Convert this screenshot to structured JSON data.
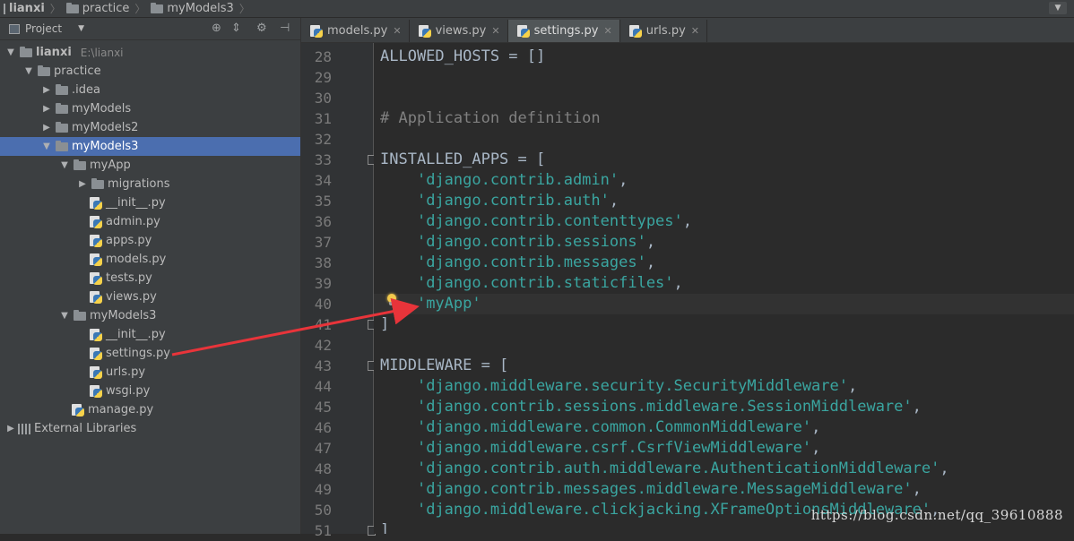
{
  "breadcrumb": [
    "lianxi",
    "practice",
    "myModels3"
  ],
  "project_panel": {
    "title": "Project",
    "root_name": "lianxi",
    "root_path": "E:\\lianxi",
    "tree": [
      {
        "label": "lianxi",
        "depth": 0,
        "type": "root",
        "expanded": true
      },
      {
        "label": "practice",
        "depth": 1,
        "type": "folder",
        "expanded": true
      },
      {
        "label": ".idea",
        "depth": 2,
        "type": "folder",
        "expanded": false
      },
      {
        "label": "myModels",
        "depth": 2,
        "type": "folder",
        "expanded": false
      },
      {
        "label": "myModels2",
        "depth": 2,
        "type": "folder",
        "expanded": false
      },
      {
        "label": "myModels3",
        "depth": 2,
        "type": "folder",
        "expanded": true,
        "selected": true
      },
      {
        "label": "myApp",
        "depth": 3,
        "type": "folder",
        "expanded": true
      },
      {
        "label": "migrations",
        "depth": 4,
        "type": "folder",
        "expanded": false
      },
      {
        "label": "__init__.py",
        "depth": 4,
        "type": "py"
      },
      {
        "label": "admin.py",
        "depth": 4,
        "type": "py"
      },
      {
        "label": "apps.py",
        "depth": 4,
        "type": "py"
      },
      {
        "label": "models.py",
        "depth": 4,
        "type": "py"
      },
      {
        "label": "tests.py",
        "depth": 4,
        "type": "py"
      },
      {
        "label": "views.py",
        "depth": 4,
        "type": "py"
      },
      {
        "label": "myModels3",
        "depth": 3,
        "type": "folder",
        "expanded": true
      },
      {
        "label": "__init__.py",
        "depth": 4,
        "type": "py"
      },
      {
        "label": "settings.py",
        "depth": 4,
        "type": "py"
      },
      {
        "label": "urls.py",
        "depth": 4,
        "type": "py"
      },
      {
        "label": "wsgi.py",
        "depth": 4,
        "type": "py"
      },
      {
        "label": "manage.py",
        "depth": 3,
        "type": "py"
      },
      {
        "label": "External Libraries",
        "depth": 0,
        "type": "lib",
        "expanded": false
      }
    ]
  },
  "editor_tabs": [
    {
      "label": "models.py",
      "active": false
    },
    {
      "label": "views.py",
      "active": false
    },
    {
      "label": "settings.py",
      "active": true
    },
    {
      "label": "urls.py",
      "active": false
    }
  ],
  "code": [
    {
      "n": "28",
      "tokens": [
        [
          "kw",
          "ALLOWED_HOSTS = []"
        ]
      ]
    },
    {
      "n": "29",
      "tokens": []
    },
    {
      "n": "30",
      "tokens": []
    },
    {
      "n": "31",
      "tokens": [
        [
          "cm",
          "# Application definition"
        ]
      ]
    },
    {
      "n": "32",
      "tokens": []
    },
    {
      "n": "33",
      "tokens": [
        [
          "kw",
          "INSTALLED_APPS = ["
        ]
      ],
      "fold": true
    },
    {
      "n": "34",
      "tokens": [
        [
          "kw",
          "    "
        ],
        [
          "str",
          "'django.contrib.admin'"
        ],
        [
          "kw",
          ","
        ]
      ]
    },
    {
      "n": "35",
      "tokens": [
        [
          "kw",
          "    "
        ],
        [
          "str",
          "'django.contrib.auth'"
        ],
        [
          "kw",
          ","
        ]
      ]
    },
    {
      "n": "36",
      "tokens": [
        [
          "kw",
          "    "
        ],
        [
          "str",
          "'django.contrib.contenttypes'"
        ],
        [
          "kw",
          ","
        ]
      ]
    },
    {
      "n": "37",
      "tokens": [
        [
          "kw",
          "    "
        ],
        [
          "str",
          "'django.contrib.sessions'"
        ],
        [
          "kw",
          ","
        ]
      ]
    },
    {
      "n": "38",
      "tokens": [
        [
          "kw",
          "    "
        ],
        [
          "str",
          "'django.contrib.messages'"
        ],
        [
          "kw",
          ","
        ]
      ]
    },
    {
      "n": "39",
      "tokens": [
        [
          "kw",
          "    "
        ],
        [
          "str",
          "'django.contrib.staticfiles'"
        ],
        [
          "kw",
          ","
        ]
      ]
    },
    {
      "n": "40",
      "tokens": [
        [
          "kw",
          "    "
        ],
        [
          "str",
          "'myApp'"
        ]
      ],
      "caret": true
    },
    {
      "n": "41",
      "tokens": [
        [
          "kw",
          "]"
        ]
      ],
      "fold": true
    },
    {
      "n": "42",
      "tokens": []
    },
    {
      "n": "43",
      "tokens": [
        [
          "kw",
          "MIDDLEWARE = ["
        ]
      ],
      "fold": true
    },
    {
      "n": "44",
      "tokens": [
        [
          "kw",
          "    "
        ],
        [
          "str",
          "'django.middleware.security.SecurityMiddleware'"
        ],
        [
          "kw",
          ","
        ]
      ]
    },
    {
      "n": "45",
      "tokens": [
        [
          "kw",
          "    "
        ],
        [
          "str",
          "'django.contrib.sessions.middleware.SessionMiddleware'"
        ],
        [
          "kw",
          ","
        ]
      ]
    },
    {
      "n": "46",
      "tokens": [
        [
          "kw",
          "    "
        ],
        [
          "str",
          "'django.middleware.common.CommonMiddleware'"
        ],
        [
          "kw",
          ","
        ]
      ]
    },
    {
      "n": "47",
      "tokens": [
        [
          "kw",
          "    "
        ],
        [
          "str",
          "'django.middleware.csrf.CsrfViewMiddleware'"
        ],
        [
          "kw",
          ","
        ]
      ]
    },
    {
      "n": "48",
      "tokens": [
        [
          "kw",
          "    "
        ],
        [
          "str",
          "'django.contrib.auth.middleware.AuthenticationMiddleware'"
        ],
        [
          "kw",
          ","
        ]
      ]
    },
    {
      "n": "49",
      "tokens": [
        [
          "kw",
          "    "
        ],
        [
          "str",
          "'django.contrib.messages.middleware.MessageMiddleware'"
        ],
        [
          "kw",
          ","
        ]
      ]
    },
    {
      "n": "50",
      "tokens": [
        [
          "kw",
          "    "
        ],
        [
          "str",
          "'django.middleware.clickjacking.XFrameOptionsMiddleware'"
        ],
        [
          "kw",
          ","
        ]
      ]
    },
    {
      "n": "51",
      "tokens": [
        [
          "kw",
          "]"
        ]
      ],
      "fold": true
    }
  ],
  "watermark": "https://blog.csdn.net/qq_39610888",
  "colors": {
    "selection": "#4b6eaf",
    "annotation_arrow": "#e8343a",
    "string": "#3aa5a0",
    "background": "#2b2b2b"
  },
  "icons": [
    "folder-icon",
    "python-file-icon",
    "library-icon",
    "lightbulb-icon",
    "gear-icon",
    "locate-icon",
    "collapse-icon"
  ]
}
